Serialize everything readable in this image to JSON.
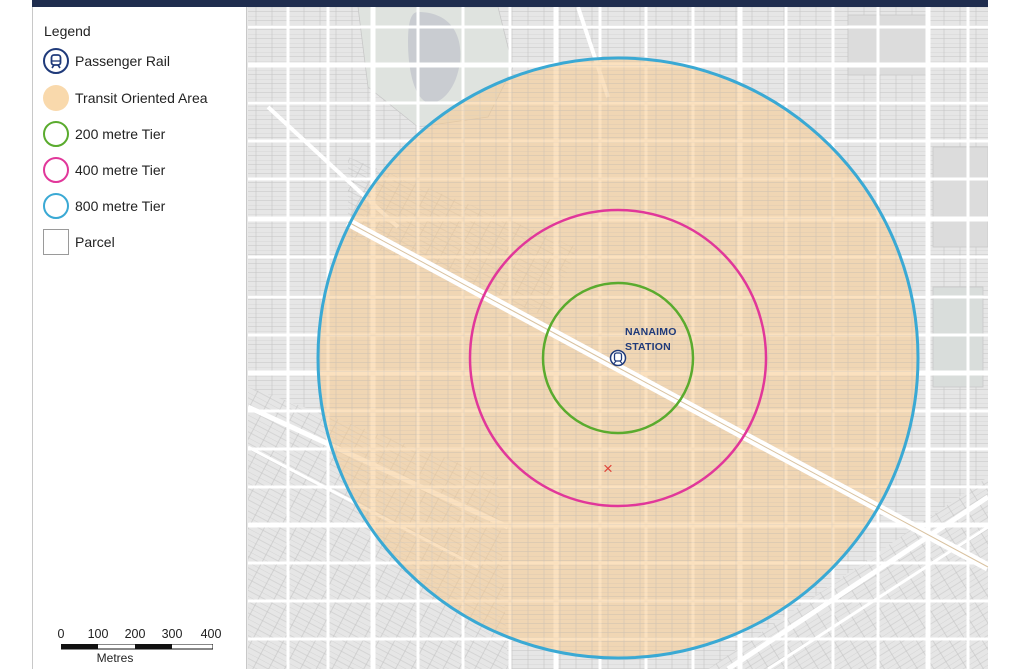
{
  "legend": {
    "title": "Legend",
    "items": [
      {
        "label": "Passenger Rail",
        "kind": "rail",
        "color": "#1f3a7a"
      },
      {
        "label": "Transit Oriented Area",
        "kind": "fill",
        "color": "#f9d9ac"
      },
      {
        "label": "200 metre Tier",
        "kind": "ring",
        "color": "#5aab2e"
      },
      {
        "label": "400 metre Tier",
        "kind": "ring",
        "color": "#e1379a"
      },
      {
        "label": "800 metre Tier",
        "kind": "ring",
        "color": "#3aa9d4"
      },
      {
        "label": "Parcel",
        "kind": "box",
        "color": "#9a9a9a"
      }
    ]
  },
  "scale_bar": {
    "ticks": [
      "0",
      "100",
      "200",
      "300",
      "400"
    ],
    "unit": "Metres"
  },
  "map": {
    "station": {
      "line1": "NANAIMO",
      "line2": "STATION",
      "icon": "rail-station-icon"
    },
    "marker": {
      "symbol": "×",
      "icon": "x-marker-icon",
      "color": "#e0453a"
    },
    "colors": {
      "toa_fill": "#f9d9ac",
      "tier_200": "#5aab2e",
      "tier_400": "#e1379a",
      "tier_800": "#3aa9d4",
      "frame": "#1f2d4e",
      "parcel_line": "#bdbdbd",
      "road": "#ffffff",
      "water": "#c9ccd1"
    }
  }
}
